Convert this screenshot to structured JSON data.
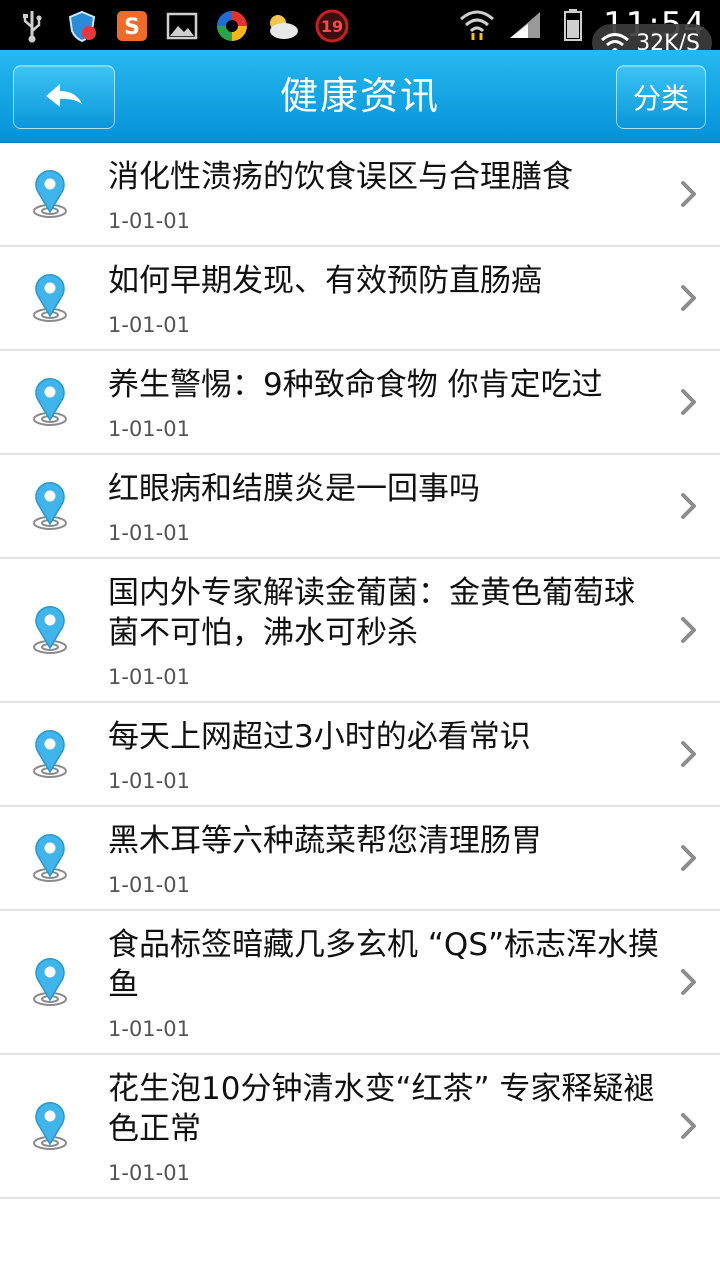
{
  "status_bar": {
    "time": "11:54",
    "net_speed": "32K/S",
    "notification_badge": "19",
    "icons": [
      "usb-icon",
      "security-shield-icon",
      "sogou-input-icon",
      "gallery-icon",
      "app-circle-icon",
      "weather-icon",
      "notification-badge-icon",
      "wifi-icon",
      "signal-icon",
      "battery-icon"
    ]
  },
  "header": {
    "title": "健康资讯",
    "category_label": "分类"
  },
  "colors": {
    "header_blue": "#0a9ee0",
    "pin_blue": "#3fb3ea",
    "divider": "#e3e3e3"
  },
  "news": [
    {
      "title": "消化性溃疡的饮食误区与合理膳食",
      "date": "1-01-01"
    },
    {
      "title": "如何早期发现、有效预防直肠癌",
      "date": "1-01-01"
    },
    {
      "title": "养生警惕：9种致命食物 你肯定吃过",
      "date": "1-01-01"
    },
    {
      "title": "红眼病和结膜炎是一回事吗",
      "date": "1-01-01"
    },
    {
      "title": "国内外专家解读金葡菌：金黄色葡萄球菌不可怕，沸水可秒杀",
      "date": "1-01-01"
    },
    {
      "title": "每天上网超过3小时的必看常识",
      "date": "1-01-01"
    },
    {
      "title": "黑木耳等六种蔬菜帮您清理肠胃",
      "date": "1-01-01"
    },
    {
      "title": "食品标签暗藏几多玄机 “QS”标志浑水摸鱼",
      "date": "1-01-01"
    },
    {
      "title": "花生泡10分钟清水变“红茶” 专家释疑褪色正常",
      "date": "1-01-01"
    }
  ]
}
